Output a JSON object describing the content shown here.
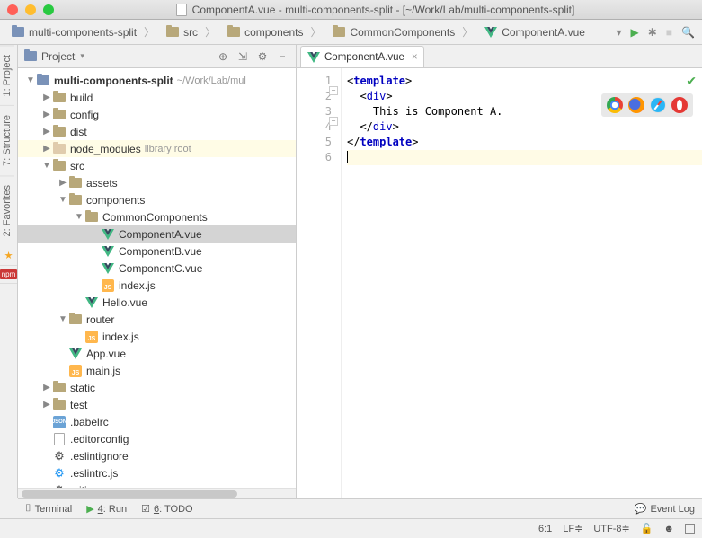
{
  "title": {
    "filename": "ComponentA.vue",
    "project": "multi-components-split",
    "path": "[~/Work/Lab/multi-components-split]"
  },
  "breadcrumbs": [
    {
      "label": "multi-components-split",
      "icon": "folder-proj"
    },
    {
      "label": "src",
      "icon": "folder"
    },
    {
      "label": "components",
      "icon": "folder"
    },
    {
      "label": "CommonComponents",
      "icon": "folder"
    },
    {
      "label": "ComponentA.vue",
      "icon": "vue"
    }
  ],
  "leftTabs": [
    "1: Project",
    "7: Structure",
    "2: Favorites"
  ],
  "panel": {
    "title": "Project"
  },
  "tree": [
    {
      "d": 0,
      "x": "open",
      "i": "folder-proj",
      "label": "multi-components-split",
      "note": "~/Work/Lab/mul"
    },
    {
      "d": 1,
      "x": "closed",
      "i": "folder",
      "label": "build"
    },
    {
      "d": 1,
      "x": "closed",
      "i": "folder",
      "label": "config"
    },
    {
      "d": 1,
      "x": "closed",
      "i": "folder",
      "label": "dist"
    },
    {
      "d": 1,
      "x": "closed",
      "i": "folder-lib",
      "label": "node_modules",
      "note": "library root",
      "lib": true
    },
    {
      "d": 1,
      "x": "open",
      "i": "folder",
      "label": "src"
    },
    {
      "d": 2,
      "x": "closed",
      "i": "folder",
      "label": "assets"
    },
    {
      "d": 2,
      "x": "open",
      "i": "folder",
      "label": "components"
    },
    {
      "d": 3,
      "x": "open",
      "i": "folder",
      "label": "CommonComponents"
    },
    {
      "d": 4,
      "x": "",
      "i": "vue",
      "label": "ComponentA.vue",
      "sel": true
    },
    {
      "d": 4,
      "x": "",
      "i": "vue",
      "label": "ComponentB.vue"
    },
    {
      "d": 4,
      "x": "",
      "i": "vue",
      "label": "ComponentC.vue"
    },
    {
      "d": 4,
      "x": "",
      "i": "js",
      "label": "index.js"
    },
    {
      "d": 3,
      "x": "",
      "i": "vue",
      "label": "Hello.vue"
    },
    {
      "d": 2,
      "x": "open",
      "i": "folder",
      "label": "router"
    },
    {
      "d": 3,
      "x": "",
      "i": "js",
      "label": "index.js"
    },
    {
      "d": 2,
      "x": "",
      "i": "vue",
      "label": "App.vue"
    },
    {
      "d": 2,
      "x": "",
      "i": "js",
      "label": "main.js"
    },
    {
      "d": 1,
      "x": "closed",
      "i": "folder",
      "label": "static"
    },
    {
      "d": 1,
      "x": "closed",
      "i": "folder",
      "label": "test"
    },
    {
      "d": 1,
      "x": "",
      "i": "json",
      "label": ".babelrc"
    },
    {
      "d": 1,
      "x": "",
      "i": "file",
      "label": ".editorconfig"
    },
    {
      "d": 1,
      "x": "",
      "i": "gear",
      "label": ".eslintignore"
    },
    {
      "d": 1,
      "x": "",
      "i": "gear-blue",
      "label": ".eslintrc.js"
    },
    {
      "d": 1,
      "x": "",
      "i": "gear",
      "label": ".gitignore"
    }
  ],
  "editor": {
    "tab": "ComponentA.vue",
    "lines": [
      {
        "n": 1,
        "type": "tag-open",
        "name": "template"
      },
      {
        "n": 2,
        "type": "tag-open",
        "name": "div",
        "indent": "  ",
        "fold": true
      },
      {
        "n": 3,
        "type": "text",
        "text": "    This is Component A."
      },
      {
        "n": 4,
        "type": "tag-close",
        "name": "div",
        "indent": "  ",
        "fold": true
      },
      {
        "n": 5,
        "type": "tag-close",
        "name": "template"
      },
      {
        "n": 6,
        "type": "cursor",
        "current": true
      }
    ]
  },
  "bottom": {
    "terminal": "Terminal",
    "run": "4: Run",
    "todo": "6: TODO",
    "eventLog": "Event Log"
  },
  "status": {
    "pos": "6:1",
    "le": "LF",
    "enc": "UTF-8"
  },
  "npmLabel": "npm"
}
